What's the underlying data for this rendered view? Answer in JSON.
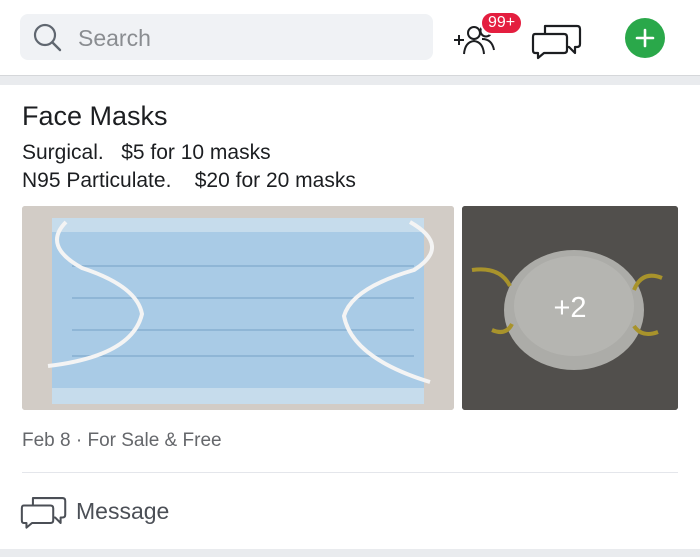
{
  "search": {
    "placeholder": "Search"
  },
  "header": {
    "notification_badge": "99+",
    "add_friend_icon": "add-people-icon",
    "messages_icon": "chat-bubbles-icon",
    "create_icon": "plus-icon"
  },
  "post": {
    "title": "Face Masks",
    "lines": [
      "Surgical.   $5 for 10 masks",
      "N95 Particulate.    $20 for 20 masks"
    ],
    "more_photos": "+2",
    "meta": "Feb 8 · For Sale & Free",
    "message_label": "Message"
  },
  "colors": {
    "accent_green": "#2aa84a",
    "badge_red": "#e41e3f",
    "mask_blue": "#a9cbe6"
  }
}
